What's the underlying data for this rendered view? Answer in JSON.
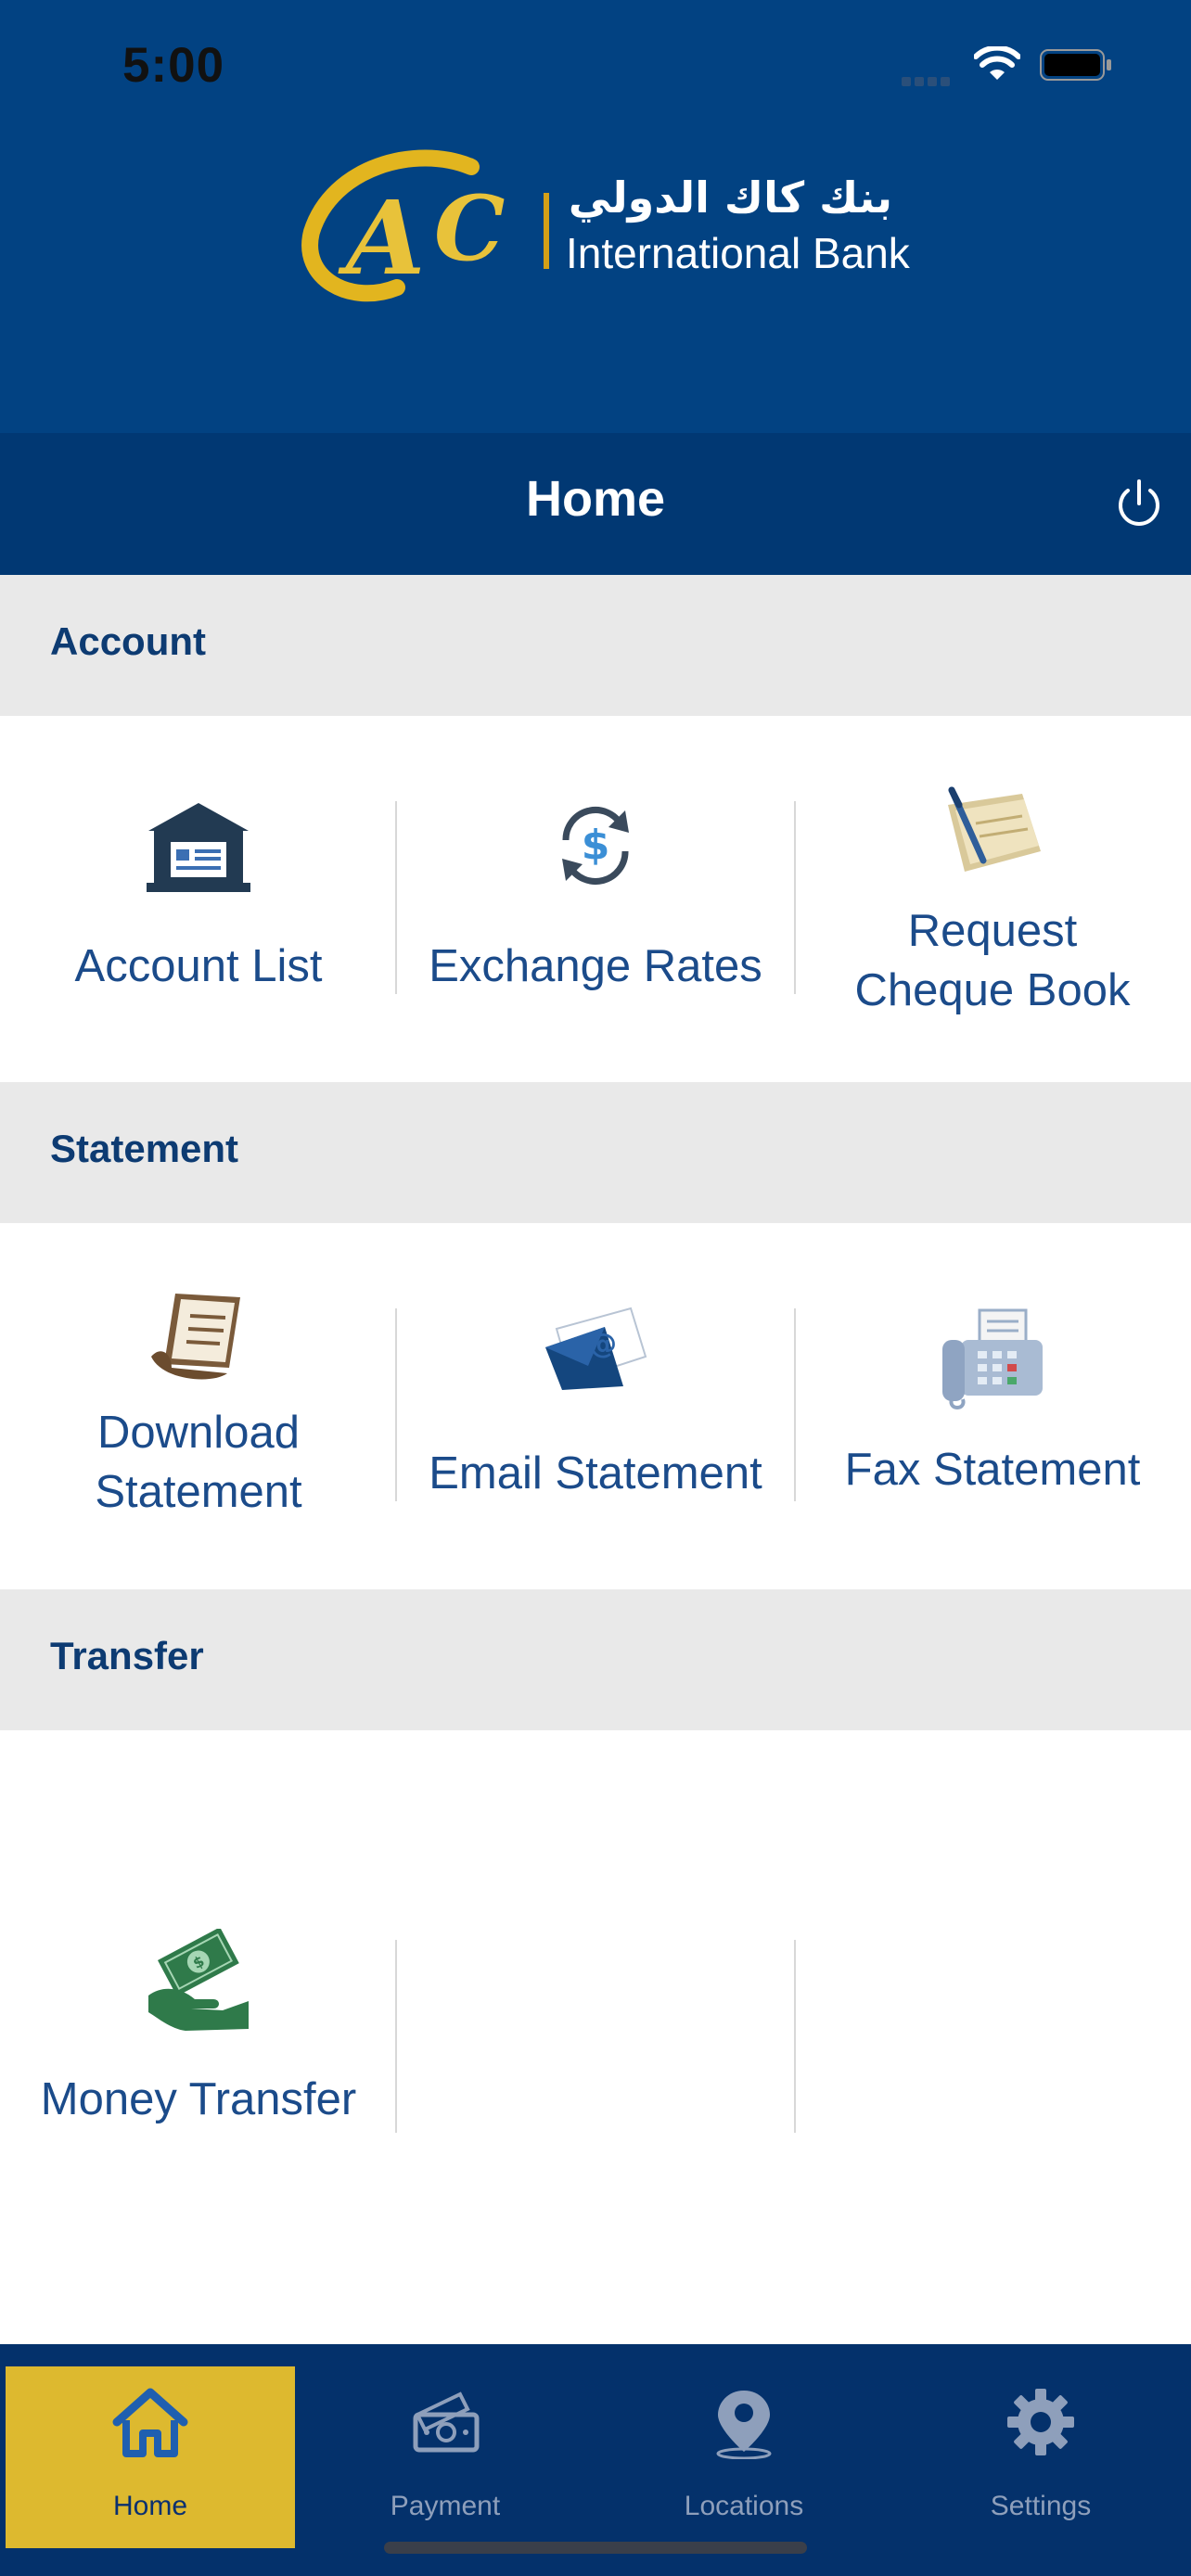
{
  "status_bar": {
    "time": "5:00"
  },
  "brand": {
    "logo_letters": "CAC",
    "arabic_name": "بنك كاك الدولي",
    "english_name": "International Bank"
  },
  "navbar": {
    "title": "Home",
    "logout_icon": "power-icon"
  },
  "sections": {
    "account": {
      "title": "Account",
      "tiles": [
        {
          "label": "Account List",
          "icon": "bank-icon"
        },
        {
          "label": "Exchange Rates",
          "icon": "currency-exchange-icon"
        },
        {
          "label": "Request Cheque Book",
          "line1": "Request",
          "line2": "Cheque Book",
          "icon": "cheque-book-icon"
        }
      ]
    },
    "statement": {
      "title": "Statement",
      "tiles": [
        {
          "label": "Download Statement",
          "line1": "Download",
          "line2": "Statement",
          "icon": "document-download-icon"
        },
        {
          "label": "Email Statement",
          "icon": "email-icon"
        },
        {
          "label": "Fax Statement",
          "icon": "fax-icon"
        }
      ]
    },
    "transfer": {
      "title": "Transfer",
      "tiles": [
        {
          "label": "Money Transfer",
          "icon": "money-transfer-icon"
        }
      ]
    }
  },
  "tab_bar": {
    "tabs": [
      {
        "label": "Home",
        "icon": "home-icon",
        "active": true
      },
      {
        "label": "Payment",
        "icon": "payment-icon",
        "active": false
      },
      {
        "label": "Locations",
        "icon": "location-pin-icon",
        "active": false
      },
      {
        "label": "Settings",
        "icon": "gear-icon",
        "active": false
      }
    ]
  },
  "colors": {
    "header_blue": "#024282",
    "navbar_blue": "#013873",
    "section_grey": "#e9e9e9",
    "label_blue": "#1b4b8a",
    "tab_bar_blue": "#04316b",
    "active_tab_gold": "#ddb92f"
  }
}
